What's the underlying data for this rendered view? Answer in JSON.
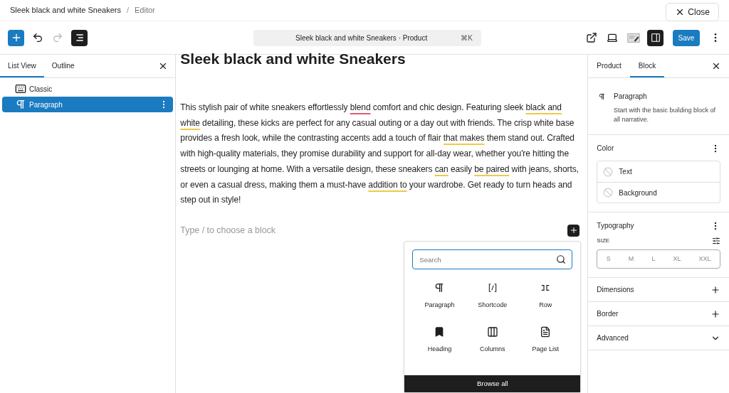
{
  "top_bar": {
    "title": "Sleek black and white Sneakers",
    "separator": "/",
    "section": "Editor",
    "close_button": "Close"
  },
  "toolbar": {
    "undo_disabled": false,
    "redo_disabled": true,
    "list_view_pressed": true,
    "command_bar": "Sleek black and white Sneakers · Product",
    "shortcut": "⌘K",
    "settings_pressed": true,
    "save_button": "Save"
  },
  "left_sidebar": {
    "tabs": [
      {
        "label": "List View",
        "selected": true
      },
      {
        "label": "Outline",
        "selected": false
      }
    ],
    "items": [
      {
        "kind": "classic",
        "label": "Classic",
        "selected": false
      },
      {
        "kind": "paragraph",
        "label": "Paragraph",
        "selected": true
      }
    ]
  },
  "canvas": {
    "heading": "Sleek black and white Sneakers",
    "paragraph": [
      {
        "text": "This stylish pair of white sneakers effortlessly ",
        "kind": "none"
      },
      {
        "text": "blend",
        "kind": "spelling"
      },
      {
        "text": " comfort and chic design. Featuring sleek ",
        "kind": "none"
      },
      {
        "text": "black and white",
        "kind": "grammar"
      },
      {
        "text": " detailing, these kicks are perfect for any casual outing or a day out with friends. The crisp white base provides a fresh look, while the contrasting accents add a touch of flair ",
        "kind": "none"
      },
      {
        "text": "that makes",
        "kind": "grammar"
      },
      {
        "text": " them stand out. Crafted with high-quality materials, they promise durability and support for all-day wear, whether you're hitting the streets or lounging at home. With a versatile design, these sneakers ",
        "kind": "none"
      },
      {
        "text": "can",
        "kind": "grammar"
      },
      {
        "text": " easily ",
        "kind": "none"
      },
      {
        "text": "be paired",
        "kind": "grammar"
      },
      {
        "text": " with jeans, shorts, or even a casual dress, making them a must-have ",
        "kind": "none"
      },
      {
        "text": "addition to",
        "kind": "grammar"
      },
      {
        "text": " your wardrobe. Get ready to turn heads and step out in style!",
        "kind": "none"
      }
    ],
    "block_placeholder": "Type / to choose a block"
  },
  "inserter": {
    "search_placeholder": "Search",
    "blocks": [
      {
        "kind": "paragraph",
        "label": "Paragraph"
      },
      {
        "kind": "shortcode",
        "label": "Shortcode"
      },
      {
        "kind": "row",
        "label": "Row"
      },
      {
        "kind": "heading",
        "label": "Heading"
      },
      {
        "kind": "columns",
        "label": "Columns"
      },
      {
        "kind": "page-list",
        "label": "Page List"
      }
    ],
    "browse_all": "Browse all"
  },
  "right_sidebar": {
    "tabs": [
      {
        "label": "Product",
        "selected": false
      },
      {
        "label": "Block",
        "selected": true
      }
    ],
    "block": {
      "name": "Paragraph",
      "description": "Start with the basic building block of all narrative."
    },
    "color": {
      "title": "Color",
      "items": [
        "Text",
        "Background"
      ]
    },
    "typography": {
      "title": "Typography",
      "size_label": "SIZE",
      "sizes": [
        {
          "label": "S",
          "selected": false
        },
        {
          "label": "M",
          "selected": false
        },
        {
          "label": "L",
          "selected": false
        },
        {
          "label": "XL",
          "selected": false
        },
        {
          "label": "XXL",
          "selected": false
        }
      ]
    },
    "panels": [
      {
        "title": "Dimensions",
        "kind": "add"
      },
      {
        "title": "Border",
        "kind": "add"
      },
      {
        "title": "Advanced",
        "kind": "expand"
      }
    ]
  }
}
